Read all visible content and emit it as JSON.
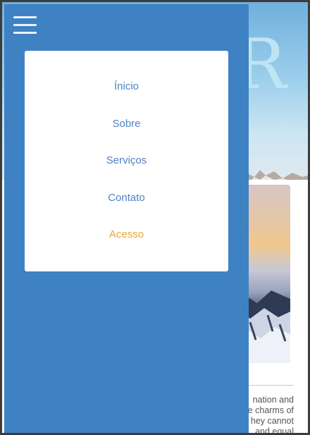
{
  "hero": {
    "decorative_letter": "R"
  },
  "drawer": {
    "menu_icon": "hamburger-menu-icon",
    "items": [
      {
        "label": "Ínicio",
        "active": false
      },
      {
        "label": "Sobre",
        "active": false
      },
      {
        "label": "Serviços",
        "active": false
      },
      {
        "label": "Contato",
        "active": false
      },
      {
        "label": "Acesso",
        "active": true
      }
    ]
  },
  "content": {
    "text_lines": [
      "nation and",
      "e charms of",
      "hey cannot",
      "and equal"
    ]
  },
  "colors": {
    "drawer_background": "#3e82c4",
    "menu_link": "#4b83c6",
    "menu_link_active": "#e8a733",
    "hero_letter": "#bfe4f2"
  }
}
